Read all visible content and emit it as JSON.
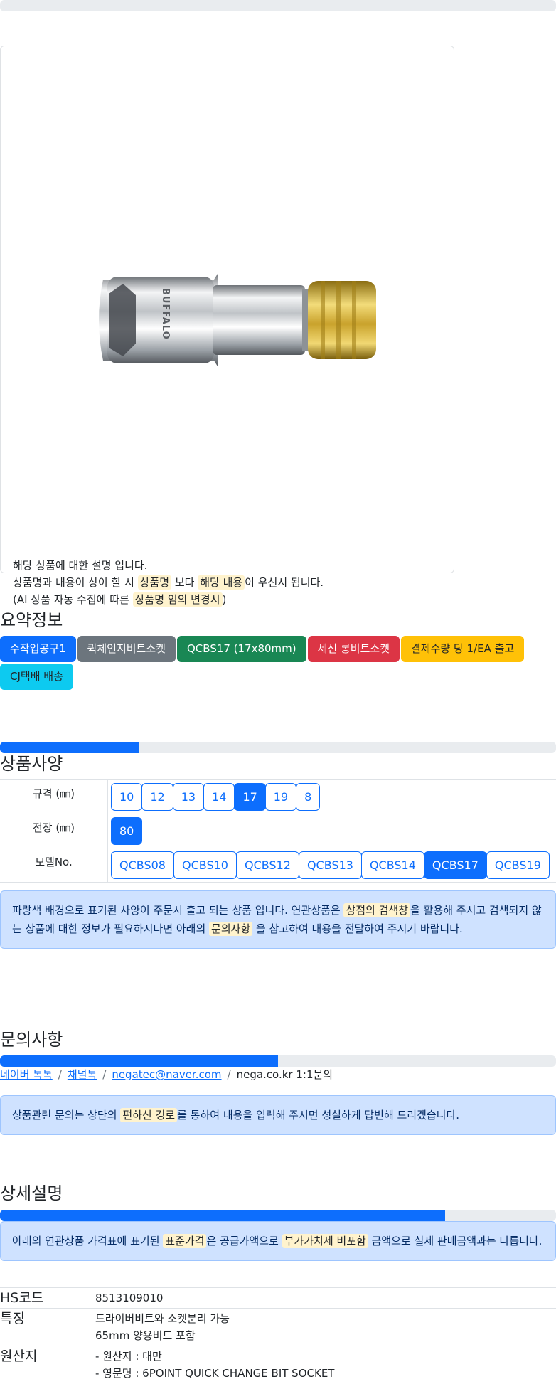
{
  "product_card": {
    "brand_on_product": "BUFFALO",
    "desc_line1": "해당 상품에 대한 설명 입니다.",
    "desc_line2_pre": "상품명과 내용이 상이 할 시 ",
    "desc_line2_hl1": "상품명",
    "desc_line2_mid": " 보다 ",
    "desc_line2_hl2": "해당 내용",
    "desc_line2_post": "이 우선시 됩니다.",
    "desc_line3_pre": "(AI 상품 자동 수집에 따른 ",
    "desc_line3_hl": "상품명 임의 변경시",
    "desc_line3_post": ")"
  },
  "summary": {
    "title": "요약정보",
    "badges": [
      {
        "label": "수작업공구1",
        "color": "#0d6efd"
      },
      {
        "label": "퀵체인지비트소켓",
        "color": "#6c757d"
      },
      {
        "label": "QCBS17 (17x80mm)",
        "color": "#198754"
      },
      {
        "label": "세신 롱비트소켓",
        "color": "#dc3545"
      },
      {
        "label": "결제수량 당 1/EA 출고",
        "color": "#ffc107"
      },
      {
        "label": "CJ택배 배송",
        "color": "#0dcaf0"
      }
    ]
  },
  "specs": {
    "title": "상품사양",
    "progress": 0.25,
    "rows": [
      {
        "label": "규격 (㎜)",
        "options": [
          "10",
          "12",
          "13",
          "14",
          "17",
          "19",
          "8"
        ],
        "selected": "17"
      },
      {
        "label": "전장 (㎜)",
        "options": [
          "80"
        ],
        "selected": "80"
      },
      {
        "label": "모델No.",
        "options": [
          "QCBS08",
          "QCBS10",
          "QCBS12",
          "QCBS13",
          "QCBS14",
          "QCBS17",
          "QCBS19"
        ],
        "selected": "QCBS17"
      }
    ],
    "notice_pre": "파랑색 배경으로 표기된 사양이 주문시 출고 되는 상품 입니다. 연관상품은 ",
    "notice_hl1": "상점의 검색창",
    "notice_mid": "을 활용해 주시고 검색되지 않는 상품에 대한 정보가 필요하시다면 아래의 ",
    "notice_hl2": "문의사항",
    "notice_post": " 을 참고하여 내용을 전달하여 주시기 바랍니다."
  },
  "inquiry": {
    "title": "문의사항",
    "progress": 0.5,
    "links": [
      "네이버 톡톡",
      "채널톡",
      "negatec@naver.com"
    ],
    "separator": "/",
    "last": "nega.co.kr 1:1문의",
    "notice_pre": "상품관련 문의는 상단의 ",
    "notice_hl": "편하신 경로",
    "notice_post": "를 통하여 내용을 입력해 주시면 성실하게 답변해 드리겠습니다."
  },
  "details": {
    "title": "상세설명",
    "progress": 0.8,
    "notice_pre": "아래의 연관상품 가격표에 표기된 ",
    "notice_hl1": "표준가격",
    "notice_mid": "은 공급가액으로 ",
    "notice_hl2": "부가가치세 비포함",
    "notice_post": " 금액으로 실제 판매금액과는 다릅니다.",
    "rows": [
      {
        "key": "HS코드",
        "lines": [
          "8513109010"
        ]
      },
      {
        "key": "특징",
        "lines": [
          "드라이버비트와 소켓분리 가능",
          "65mm 양용비트 포함"
        ]
      },
      {
        "key": "원산지",
        "lines": [
          "- 원산지 : 대만",
          "- 영문명 : 6POINT QUICK CHANGE BIT SOCKET"
        ]
      }
    ]
  }
}
